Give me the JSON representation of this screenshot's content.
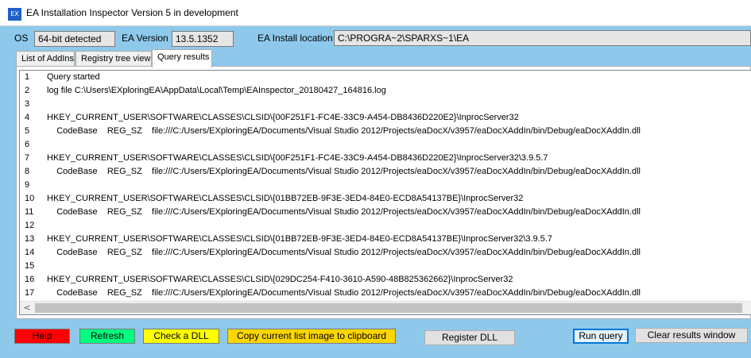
{
  "window": {
    "icon": "EX",
    "title": "EA Installation Inspector Version 5 in development"
  },
  "info": {
    "os_label": "OS",
    "os_value": "64-bit detected",
    "ea_version_label": "EA Version",
    "ea_version_value": "13.5.1352",
    "install_label": "EA Install location",
    "install_value": "C:\\PROGRA~2\\SPARXS~1\\EA"
  },
  "tabs": [
    {
      "label": "List of AddIns"
    },
    {
      "label": "Registry tree view"
    },
    {
      "label": "Query results"
    }
  ],
  "results": [
    {
      "n": "1",
      "text": "Query started"
    },
    {
      "n": "2",
      "text": "log file C:\\Users\\EXploringEA\\AppData\\Local\\Temp\\EAInspector_20180427_164816.log"
    },
    {
      "n": "3",
      "text": ""
    },
    {
      "n": "4",
      "text": "HKEY_CURRENT_USER\\SOFTWARE\\CLASSES\\CLSID\\{00F251F1-FC4E-33C9-A454-DB8436D220E2}\\InprocServer32"
    },
    {
      "n": "5",
      "text": "    CodeBase    REG_SZ    file:///C:/Users/EXploringEA/Documents/Visual Studio 2012/Projects/eaDocX/v3957/eaDocXAddIn/bin/Debug/eaDocXAddIn.dll"
    },
    {
      "n": "6",
      "text": ""
    },
    {
      "n": "7",
      "text": "HKEY_CURRENT_USER\\SOFTWARE\\CLASSES\\CLSID\\{00F251F1-FC4E-33C9-A454-DB8436D220E2}\\InprocServer32\\3.9.5.7"
    },
    {
      "n": "8",
      "text": "    CodeBase    REG_SZ    file:///C:/Users/EXploringEA/Documents/Visual Studio 2012/Projects/eaDocX/v3957/eaDocXAddIn/bin/Debug/eaDocXAddIn.dll"
    },
    {
      "n": "9",
      "text": ""
    },
    {
      "n": "10",
      "text": "HKEY_CURRENT_USER\\SOFTWARE\\CLASSES\\CLSID\\{01BB72EB-9F3E-3ED4-84E0-ECD8A54137BE}\\InprocServer32"
    },
    {
      "n": "11",
      "text": "    CodeBase    REG_SZ    file:///C:/Users/EXploringEA/Documents/Visual Studio 2012/Projects/eaDocX/v3957/eaDocXAddIn/bin/Debug/eaDocXAddIn.dll"
    },
    {
      "n": "12",
      "text": ""
    },
    {
      "n": "13",
      "text": "HKEY_CURRENT_USER\\SOFTWARE\\CLASSES\\CLSID\\{01BB72EB-9F3E-3ED4-84E0-ECD8A54137BE}\\InprocServer32\\3.9.5.7"
    },
    {
      "n": "14",
      "text": "    CodeBase    REG_SZ    file:///C:/Users/EXploringEA/Documents/Visual Studio 2012/Projects/eaDocX/v3957/eaDocXAddIn/bin/Debug/eaDocXAddIn.dll"
    },
    {
      "n": "15",
      "text": ""
    },
    {
      "n": "16",
      "text": "HKEY_CURRENT_USER\\SOFTWARE\\CLASSES\\CLSID\\{029DC254-F410-3610-A590-48B825362662}\\InprocServer32"
    },
    {
      "n": "17",
      "text": "    CodeBase    REG_SZ    file:///C:/Users/EXploringEA/Documents/Visual Studio 2012/Projects/eaDocX/v3957/eaDocXAddIn/bin/Debug/eaDocXAddIn.dll"
    },
    {
      "n": "18",
      "text": ""
    }
  ],
  "scroll_left_glyph": "<",
  "buttons": {
    "help": "Help",
    "refresh": "Refresh",
    "check_dll": "Check a DLL",
    "copy_list": "Copy current list image to clipboard",
    "register_dll": "Register DLL",
    "run_query": "Run query",
    "clear_results": "Clear results window"
  },
  "colors": {
    "help": "#ff0000",
    "refresh": "#00ff7f",
    "check_dll": "#ffff00",
    "copy_list": "#ffd700",
    "background": "#8ec9ec"
  }
}
